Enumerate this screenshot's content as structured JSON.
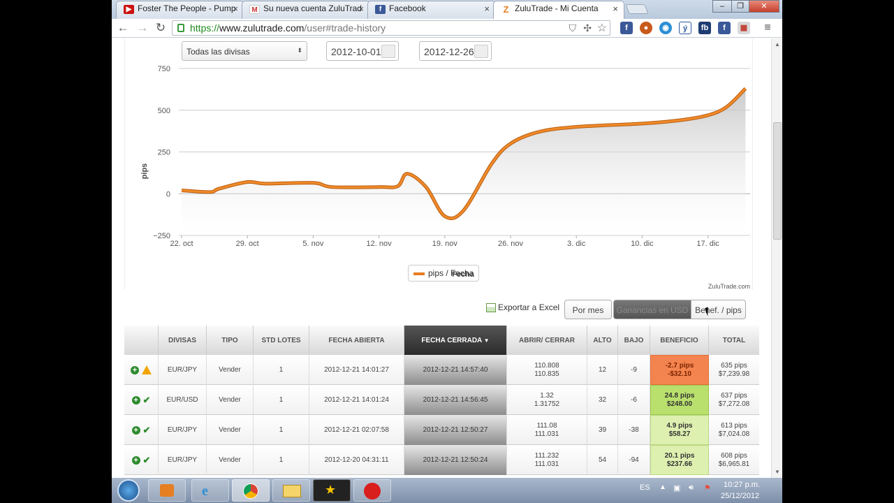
{
  "browser": {
    "tabs": [
      {
        "title": "Foster The People - Pump",
        "favicon": "youtube-icon",
        "color": "#cc1111"
      },
      {
        "title": "Su nueva cuenta ZuluTrad",
        "favicon": "gmail-icon",
        "color": "#c33"
      },
      {
        "title": "Facebook",
        "favicon": "facebook-icon",
        "color": "#3b5998"
      },
      {
        "title": "ZuluTrade - Mi Cuenta",
        "favicon": "zulutrade-icon",
        "color": "#e67e22"
      }
    ],
    "url_https": "https://",
    "url_host": "www.zulutrade.com",
    "url_path": "/user#trade-history"
  },
  "filters": {
    "currency": "Todas las divisas",
    "date_from": "2012-10-01",
    "date_to": "2012-12-26"
  },
  "chart_data": {
    "type": "area",
    "xlabel": "Fecha",
    "ylabel": "pips",
    "ylim": [
      -250,
      750
    ],
    "yticks": [
      "750",
      "500",
      "250",
      "0",
      "−250"
    ],
    "xticks": [
      "22. oct",
      "29. oct",
      "5. nov",
      "12. nov",
      "19. nov",
      "26. nov",
      "3. dic",
      "10. dic",
      "17. dic"
    ],
    "x": [
      "2012-10-22",
      "2012-10-25",
      "2012-10-26",
      "2012-10-29",
      "2012-10-31",
      "2012-11-05",
      "2012-11-07",
      "2012-11-12",
      "2012-11-14",
      "2012-11-15",
      "2012-11-17",
      "2012-11-19",
      "2012-11-21",
      "2012-11-24",
      "2012-11-26",
      "2012-11-29",
      "2012-12-03",
      "2012-12-10",
      "2012-12-14",
      "2012-12-17",
      "2012-12-19",
      "2012-12-21"
    ],
    "values": [
      20,
      10,
      30,
      70,
      60,
      65,
      40,
      40,
      45,
      120,
      40,
      -135,
      -100,
      180,
      300,
      370,
      400,
      420,
      440,
      470,
      520,
      630
    ],
    "series": [
      {
        "name": "pips / Fecha",
        "color": "#e67e22"
      }
    ],
    "legend": "pips / Fecha",
    "credit": "ZuluTrade.com"
  },
  "actions": {
    "export": "Exportar a Excel",
    "per_month": "Por mes",
    "gains_usd": "Ganancias en USD",
    "profit_pips": "Benef. / pips"
  },
  "table": {
    "headers": [
      "",
      "DIVISAS",
      "TIPO",
      "STD LOTES",
      "FECHA ABIERTA",
      "FECHA CERRADA",
      "ABRIR/ CERRAR",
      "ALTO",
      "BAJO",
      "BENEFICIO",
      "TOTAL"
    ],
    "sort_arrow": "▼",
    "rows": [
      {
        "status": "warning",
        "pair": "EUR/JPY",
        "type": "Vender",
        "lots": "1",
        "opened": "2012-12-21 14:01:27",
        "closed": "2012-12-21 14:57:40",
        "open_price": "110.808",
        "close_price": "110.835",
        "high": "12",
        "low": "-9",
        "profit_pips": "-2.7 pips",
        "profit_usd": "-$32.10",
        "total_pips": "635 pips",
        "total_usd": "$7,239.98",
        "tone": "neg"
      },
      {
        "status": "ok",
        "pair": "EUR/USD",
        "type": "Vender",
        "lots": "1",
        "opened": "2012-12-21 14:01:24",
        "closed": "2012-12-21 14:56:45",
        "open_price": "1.32",
        "close_price": "1.31752",
        "high": "32",
        "low": "-6",
        "profit_pips": "24.8 pips",
        "profit_usd": "$248.00",
        "total_pips": "637 pips",
        "total_usd": "$7,272.08",
        "tone": "pos"
      },
      {
        "status": "ok",
        "pair": "EUR/JPY",
        "type": "Vender",
        "lots": "1",
        "opened": "2012-12-21 02:07:58",
        "closed": "2012-12-21 12:50:27",
        "open_price": "111.08",
        "close_price": "111.031",
        "high": "39",
        "low": "-38",
        "profit_pips": "4.9 pips",
        "profit_usd": "$58.27",
        "total_pips": "613 pips",
        "total_usd": "$7,024.08",
        "tone": "pos2"
      },
      {
        "status": "ok",
        "pair": "EUR/JPY",
        "type": "Vender",
        "lots": "1",
        "opened": "2012-12-20 04:31:11",
        "closed": "2012-12-21 12:50:24",
        "open_price": "111.232",
        "close_price": "111.031",
        "high": "54",
        "low": "-94",
        "profit_pips": "20.1 pips",
        "profit_usd": "$237.66",
        "total_pips": "608 pips",
        "total_usd": "$6,965.81",
        "tone": "pos2"
      }
    ]
  },
  "taskbar": {
    "lang": "ES",
    "time": "10:27 p.m.",
    "date": "25/12/2012"
  }
}
